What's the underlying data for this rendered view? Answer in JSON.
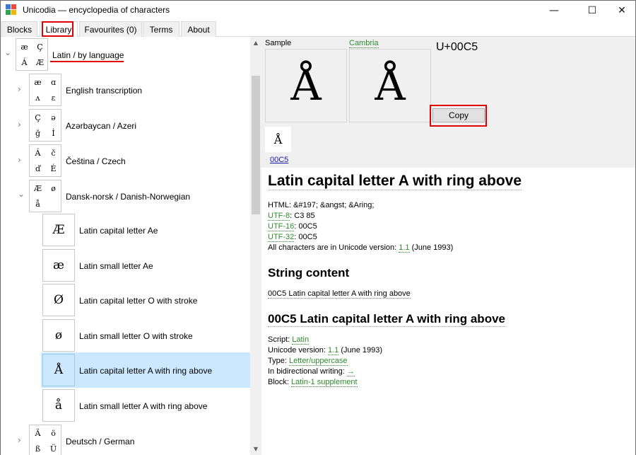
{
  "window": {
    "title": "Unicodia — encyclopedia of characters",
    "controls": {
      "minimize": "—",
      "maximize": "☐",
      "close": "✕"
    }
  },
  "tabs": [
    {
      "label": "Blocks"
    },
    {
      "label": "Library"
    },
    {
      "label": "Favourites (0)"
    },
    {
      "label": "Terms"
    },
    {
      "label": "About"
    }
  ],
  "tree": {
    "root": {
      "label": "Latin / by language",
      "glyphs": [
        "æ",
        "Ç",
        "Á",
        "Æ"
      ],
      "expander": "⌄"
    },
    "groups": [
      {
        "label": "English transcription",
        "glyphs": [
          "æ",
          "ɑ",
          "ʌ",
          "ɛ"
        ],
        "expander": "›"
      },
      {
        "label": "Azərbaycan / Azeri",
        "glyphs": [
          "Ç",
          "ə",
          "ğ",
          "İ"
        ],
        "expander": "›"
      },
      {
        "label": "Čeština / Czech",
        "glyphs": [
          "Á",
          "č",
          "ď",
          "É"
        ],
        "expander": "›"
      },
      {
        "label": "Dansk-norsk / Danish-Norwegian",
        "glyphs": [
          "Æ",
          "ø",
          "å",
          ""
        ],
        "expander": "⌄"
      }
    ],
    "chars": [
      {
        "glyph": "Æ",
        "label": "Latin capital letter Ae"
      },
      {
        "glyph": "æ",
        "label": "Latin small letter Ae"
      },
      {
        "glyph": "Ø",
        "label": "Latin capital letter O with stroke"
      },
      {
        "glyph": "ø",
        "label": "Latin small letter O with stroke"
      },
      {
        "glyph": "Å",
        "label": "Latin capital letter A with ring above",
        "selected": true
      },
      {
        "glyph": "å",
        "label": "Latin small letter A with ring above"
      }
    ],
    "last_group": {
      "label": "Deutsch / German",
      "glyphs": [
        "Ä",
        "ö",
        "ß",
        "Ü"
      ],
      "expander": "›"
    },
    "scroll_arrows": {
      "up": "▲",
      "down": "▼"
    }
  },
  "detail": {
    "sample_label": "Sample",
    "font_label": "Cambria",
    "glyph": "Å",
    "codepoint": "U+00C5",
    "copy_label": "Copy",
    "small_glyph": "Å",
    "small_code": "00C5",
    "title": "Latin capital letter A with ring above",
    "html_line": "HTML: &#197; &angst; &Aring;",
    "utf8_label": "UTF-8",
    "utf8_value": ": C3 85",
    "utf16_label": "UTF-16",
    "utf16_value": ": 00C5",
    "utf32_label": "UTF-32",
    "utf32_value": ": 00C5",
    "version_prefix": "All characters are in Unicode version: ",
    "version_link": "1.1",
    "version_suffix": " (June 1993)",
    "string_heading": "String content",
    "string_line": "00C5 Latin capital letter A with ring above",
    "char_heading": "00C5 Latin capital letter A with ring above",
    "script_label": "Script: ",
    "script_value": "Latin",
    "uver_label": "Unicode version: ",
    "uver_value": "1.1",
    "uver_suffix": " (June 1993)",
    "type_label": "Type: ",
    "type_value": "Letter/uppercase",
    "bidi_label": "In bidirectional writing: ",
    "bidi_value": "→",
    "block_label": "Block: ",
    "block_value": "Latin-1 supplement"
  },
  "colors": {
    "link": "#2e8b2e",
    "selection": "#cce8ff",
    "highlight_box": "#e00000"
  }
}
